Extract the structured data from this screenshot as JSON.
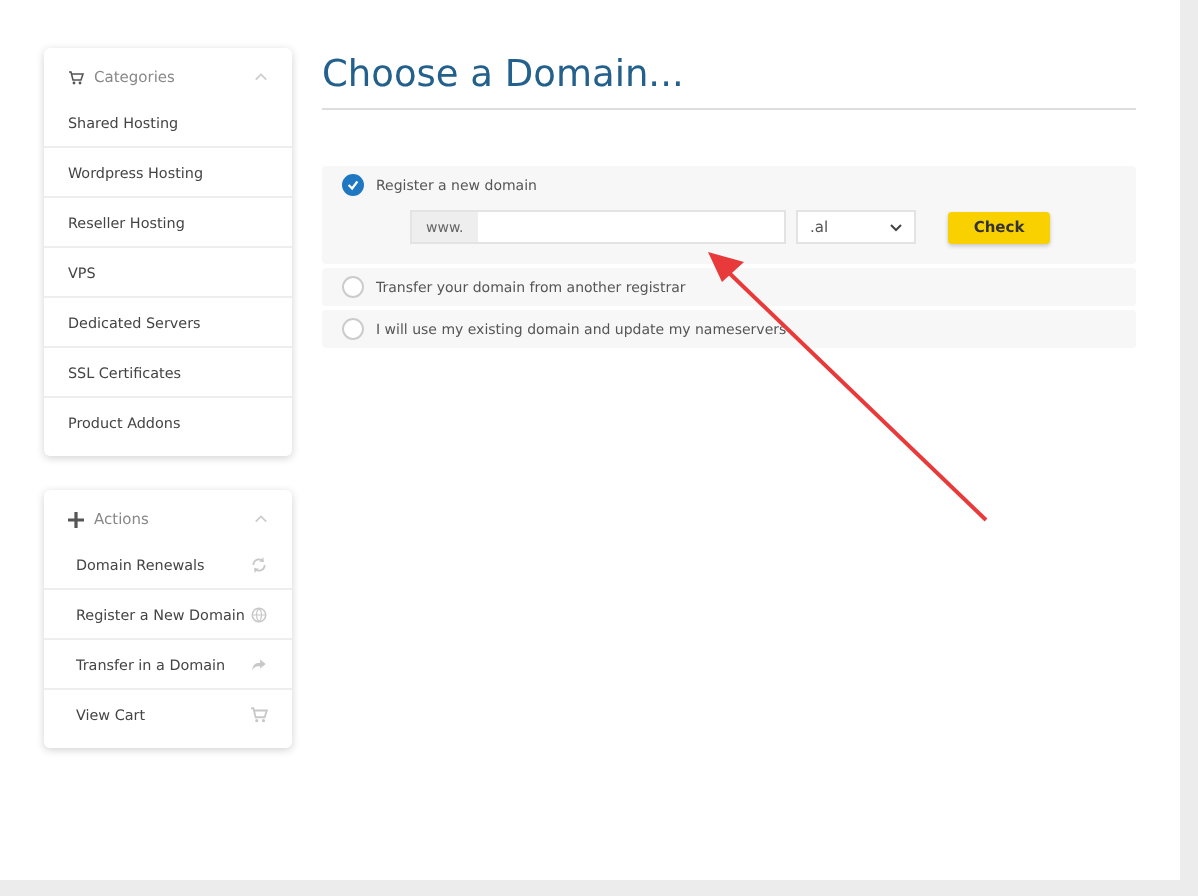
{
  "sidebar": {
    "panels": [
      {
        "kind": "categories",
        "title": "Categories",
        "expanded": true,
        "items": [
          {
            "label": "Shared Hosting"
          },
          {
            "label": "Wordpress Hosting"
          },
          {
            "label": "Reseller Hosting"
          },
          {
            "label": "VPS"
          },
          {
            "label": "Dedicated Servers"
          },
          {
            "label": "SSL Certificates"
          },
          {
            "label": "Product Addons"
          }
        ]
      },
      {
        "kind": "actions",
        "title": "Actions",
        "expanded": true,
        "items": [
          {
            "label": "Domain Renewals"
          },
          {
            "label": "Register a New Domain"
          },
          {
            "label": "Transfer in a Domain"
          },
          {
            "label": "View Cart"
          }
        ]
      }
    ]
  },
  "main": {
    "title": "Choose a Domain...",
    "options": [
      {
        "label": "Register a new domain",
        "selected": true,
        "prefix": "www.",
        "tld": ".al",
        "button": "Check"
      },
      {
        "label": "Transfer your domain from another registrar",
        "selected": false
      },
      {
        "label": "I will use my existing domain and update my nameservers",
        "selected": false
      }
    ]
  }
}
